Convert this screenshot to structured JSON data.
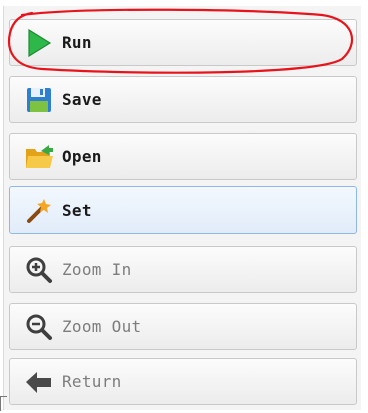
{
  "toolbar": {
    "buttons": [
      {
        "label": "Run",
        "icon": "play-icon",
        "state": "annotated"
      },
      {
        "label": "Save",
        "icon": "floppy-disk-icon",
        "state": "normal"
      },
      {
        "label": "Open",
        "icon": "open-folder-icon",
        "state": "normal"
      },
      {
        "label": "Set",
        "icon": "wand-icon",
        "state": "highlighted"
      },
      {
        "label": "Zoom In",
        "icon": "zoom-in-icon",
        "state": "disabled"
      },
      {
        "label": "Zoom Out",
        "icon": "zoom-out-icon",
        "state": "disabled"
      },
      {
        "label": "Return",
        "icon": "back-arrow-icon",
        "state": "disabled"
      }
    ]
  },
  "colors": {
    "annotation": "#e8141c",
    "play": "#2fb84a",
    "highlight_border": "#8fb8e8",
    "disabled_text": "#7d7d7d"
  }
}
